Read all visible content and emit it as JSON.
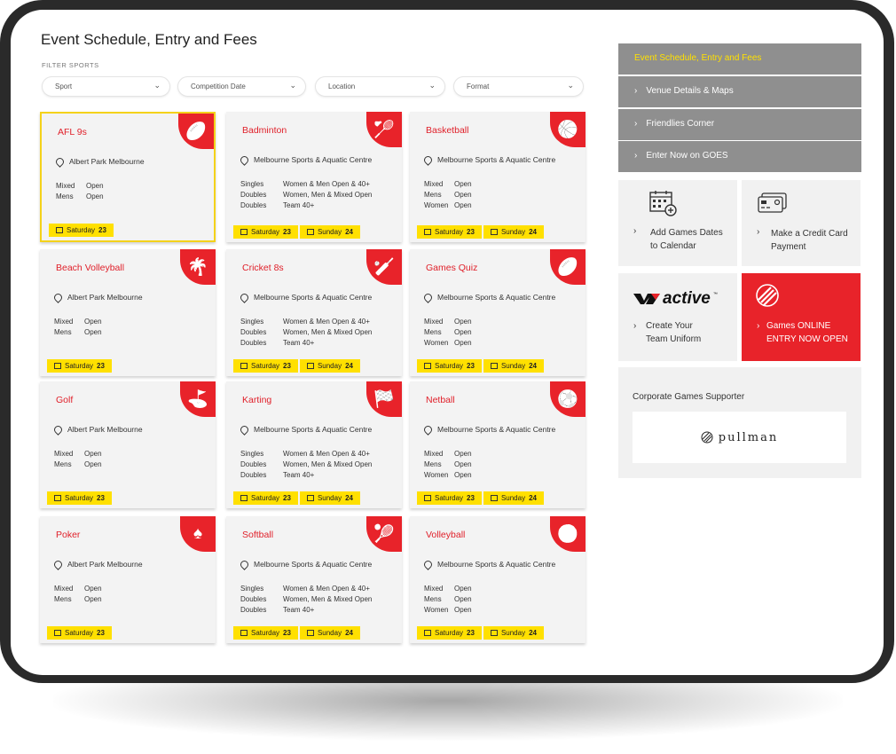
{
  "header": {
    "title": "Event Schedule, Entry and Fees",
    "filter_label": "FILTER SPORTS"
  },
  "filters": [
    {
      "label": "Sport"
    },
    {
      "label": "Competition Date"
    },
    {
      "label": "Location"
    },
    {
      "label": "Format"
    }
  ],
  "sports": [
    {
      "name": "AFL 9s",
      "icon": "afl-ball-icon",
      "location": "Albert Park Melbourne",
      "rows": [
        [
          "Mixed",
          "Open"
        ],
        [
          "Mens",
          "Open"
        ]
      ],
      "dates": [
        [
          "Saturday",
          "23"
        ]
      ]
    },
    {
      "name": "Badminton",
      "icon": "shuttlecock-icon",
      "location": "Melbourne Sports & Aquatic Centre",
      "rows": [
        [
          "Singles",
          "Women & Men Open & 40+"
        ],
        [
          "Doubles",
          "Women, Men & Mixed Open"
        ],
        [
          "Doubles",
          "Team 40+"
        ]
      ],
      "dates": [
        [
          "Saturday",
          "23"
        ],
        [
          "Sunday",
          "24"
        ]
      ]
    },
    {
      "name": "Basketball",
      "icon": "basketball-icon",
      "location": "Melbourne Sports & Aquatic Centre",
      "rows": [
        [
          "Mixed",
          "Open"
        ],
        [
          "Mens",
          "Open"
        ],
        [
          "Women",
          "Open"
        ]
      ],
      "dates": [
        [
          "Saturday",
          "23"
        ],
        [
          "Sunday",
          "24"
        ]
      ]
    },
    {
      "name": "Beach Volleyball",
      "icon": "beach-volleyball-icon",
      "location": "Albert Park Melbourne",
      "rows": [
        [
          "Mixed",
          "Open"
        ],
        [
          "Mens",
          "Open"
        ]
      ],
      "dates": [
        [
          "Saturday",
          "23"
        ]
      ]
    },
    {
      "name": "Cricket 8s",
      "icon": "cricket-icon",
      "location": "Melbourne Sports & Aquatic Centre",
      "rows": [
        [
          "Singles",
          "Women & Men Open & 40+"
        ],
        [
          "Doubles",
          "Women, Men & Mixed Open"
        ],
        [
          "Doubles",
          "Team 40+"
        ]
      ],
      "dates": [
        [
          "Saturday",
          "23"
        ],
        [
          "Sunday",
          "24"
        ]
      ]
    },
    {
      "name": "Games Quiz",
      "icon": "quiz-icon",
      "location": "Melbourne Sports & Aquatic Centre",
      "rows": [
        [
          "Mixed",
          "Open"
        ],
        [
          "Mens",
          "Open"
        ],
        [
          "Women",
          "Open"
        ]
      ],
      "dates": [
        [
          "Saturday",
          "23"
        ],
        [
          "Sunday",
          "24"
        ]
      ]
    },
    {
      "name": "Golf",
      "icon": "golf-flag-icon",
      "location": "Albert Park Melbourne",
      "rows": [
        [
          "Mixed",
          "Open"
        ],
        [
          "Mens",
          "Open"
        ]
      ],
      "dates": [
        [
          "Saturday",
          "23"
        ]
      ]
    },
    {
      "name": "Karting",
      "icon": "checkered-flag-icon",
      "location": "Melbourne Sports & Aquatic Centre",
      "rows": [
        [
          "Singles",
          "Women & Men Open & 40+"
        ],
        [
          "Doubles",
          "Women, Men & Mixed Open"
        ],
        [
          "Doubles",
          "Team 40+"
        ]
      ],
      "dates": [
        [
          "Saturday",
          "23"
        ],
        [
          "Sunday",
          "24"
        ]
      ]
    },
    {
      "name": "Netball",
      "icon": "netball-icon",
      "location": "Melbourne Sports & Aquatic Centre",
      "rows": [
        [
          "Mixed",
          "Open"
        ],
        [
          "Mens",
          "Open"
        ],
        [
          "Women",
          "Open"
        ]
      ],
      "dates": [
        [
          "Saturday",
          "23"
        ],
        [
          "Sunday",
          "24"
        ]
      ]
    },
    {
      "name": "Poker",
      "icon": "spade-icon",
      "location": "Albert Park Melbourne",
      "rows": [
        [
          "Mixed",
          "Open"
        ],
        [
          "Mens",
          "Open"
        ]
      ],
      "dates": [
        [
          "Saturday",
          "23"
        ]
      ]
    },
    {
      "name": "Softball",
      "icon": "softball-icon",
      "location": "Melbourne Sports & Aquatic Centre",
      "rows": [
        [
          "Singles",
          "Women & Men Open & 40+"
        ],
        [
          "Doubles",
          "Women, Men & Mixed Open"
        ],
        [
          "Doubles",
          "Team 40+"
        ]
      ],
      "dates": [
        [
          "Saturday",
          "23"
        ],
        [
          "Sunday",
          "24"
        ]
      ]
    },
    {
      "name": "Volleyball",
      "icon": "volleyball-icon",
      "location": "Melbourne Sports & Aquatic Centre",
      "rows": [
        [
          "Mixed",
          "Open"
        ],
        [
          "Mens",
          "Open"
        ],
        [
          "Women",
          "Open"
        ]
      ],
      "dates": [
        [
          "Saturday",
          "23"
        ],
        [
          "Sunday",
          "24"
        ]
      ]
    }
  ],
  "sidebar": {
    "menu": [
      {
        "label": "Event Schedule, Entry and Fees",
        "active": true
      },
      {
        "label": "Venue Details & Maps",
        "active": false
      },
      {
        "label": "Friendlies Corner",
        "active": false
      },
      {
        "label": "Enter Now on GOES",
        "active": false
      }
    ],
    "calendar_tile": {
      "label_line1": "Add Games Dates",
      "label_line2": "to Calendar",
      "icon": "calendar-add-icon"
    },
    "payment_tile": {
      "label_line1": "Make a Credit Card",
      "label_line2": "Payment",
      "icon": "credit-card-icon"
    },
    "uniform_tile": {
      "brand": "active",
      "label_line1": "Create Your",
      "label_line2": "Team Uniform",
      "icon": "active-logo"
    },
    "entry_tile": {
      "label_line1": "Games ONLINE",
      "label_line2": "ENTRY NOW OPEN",
      "icon": "games-logo-icon"
    },
    "supporter": {
      "label": "Corporate Games Supporter",
      "brand": "pullman"
    }
  },
  "colors": {
    "accent_red": "#e8232a",
    "highlight_yellow": "#ffe000",
    "selected_border": "#f4d21a",
    "menu_grey": "#8f8f8f"
  }
}
